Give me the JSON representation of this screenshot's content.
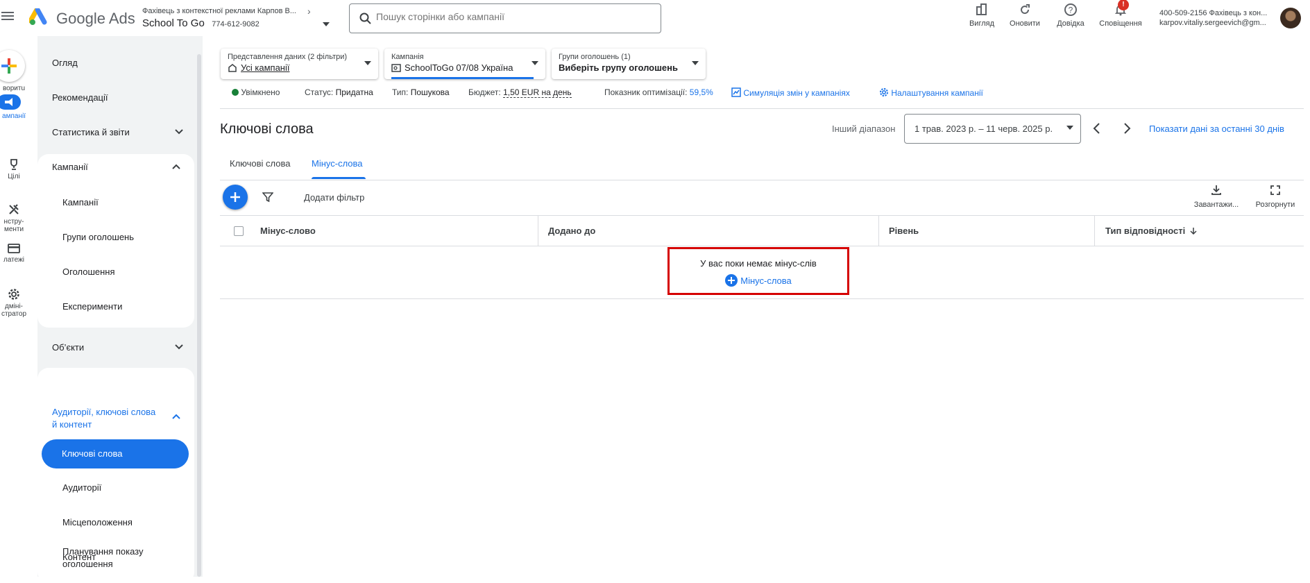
{
  "topbar": {
    "app_name": "Google Ads",
    "account_name": "Фахівець з контекстної реклами Карпов В...",
    "account_title": "School To Go",
    "account_id": "774-612-9082",
    "search_placeholder": "Пошук сторінки або кампанії",
    "buttons": [
      {
        "label": "Вигляд",
        "icon": "appearance-icon"
      },
      {
        "label": "Оновити",
        "icon": "refresh-icon"
      },
      {
        "label": "Довідка",
        "icon": "help-icon"
      },
      {
        "label": "Сповіщення",
        "icon": "bell-icon",
        "badge": "!"
      }
    ],
    "user_line1": "400-509-2156 Фахівець з кон...",
    "user_line2": "karpov.vitaliy.sergeevich@gm..."
  },
  "rail": {
    "items": [
      {
        "label": "воритu",
        "icon": "create-icon"
      },
      {
        "label": "ампанії",
        "icon": "campaigns-icon"
      },
      {
        "label": "Цілі",
        "icon": "trophy-icon"
      },
      {
        "label": "нстру-\nменти",
        "icon": "tools-icon"
      },
      {
        "label": "латежі",
        "icon": "billing-icon"
      },
      {
        "label": "дміні-\nстратор",
        "icon": "admin-icon"
      }
    ]
  },
  "nav": {
    "overview": "Огляд",
    "recommendations": "Рекомендації",
    "stats": "Статистика й звіти",
    "campaigns_group": "Кампанії",
    "campaigns_sub": [
      "Кампанії",
      "Групи оголошень",
      "Оголошення",
      "Експерименти"
    ],
    "objects": "Об’єкти",
    "audiences_group": "Аудиторії, ключові слова й контент",
    "keywords_active": "Ключові слова",
    "audiences_sub": [
      "Аудиторії",
      "Місцеположення",
      "Контент",
      "Планування показу оголошення"
    ]
  },
  "filters": {
    "view_label": "Представлення даних (2 фільтри)",
    "view_value": "Усі кампанії",
    "campaign_label": "Кампанія",
    "campaign_value": "SchoolToGo 07/08 Україна",
    "adgroup_label": "Групи оголошень (1)",
    "adgroup_value": "Виберіть групу оголошень"
  },
  "status": {
    "enabled": "Увімкнено",
    "status_label": "Статус:",
    "status_value": "Придатна",
    "type_label": "Тип:",
    "type_value": "Пошукова",
    "budget_label": "Бюджет:",
    "budget_value": "1,50 EUR на день",
    "opt_label": "Показник оптимізації:",
    "opt_value": "59,5%",
    "simulate": "Симуляція змін у кампаніях",
    "settings": "Налаштування кампанії"
  },
  "page": {
    "title": "Ключові слова",
    "range_label": "Інший діапазон",
    "range_value": "1 трав. 2023 р. – 11 черв. 2025 р.",
    "last30": "Показати дані за останні 30 днів"
  },
  "tabs": [
    "Ключові слова",
    "Мінус-слова"
  ],
  "toolbar": {
    "add_filter": "Додати фільтр",
    "download": "Завантажи...",
    "expand": "Розгорнути"
  },
  "table": {
    "columns": [
      "Мінус-слово",
      "Додано до",
      "Рівень",
      "Тип відповідності"
    ],
    "empty_text": "У вас поки немає мінус-слів",
    "empty_link": "Мінус-слова"
  },
  "colors": {
    "accent": "#1a73e8",
    "highlight_border": "#d50000",
    "enabled_dot": "#188038"
  }
}
